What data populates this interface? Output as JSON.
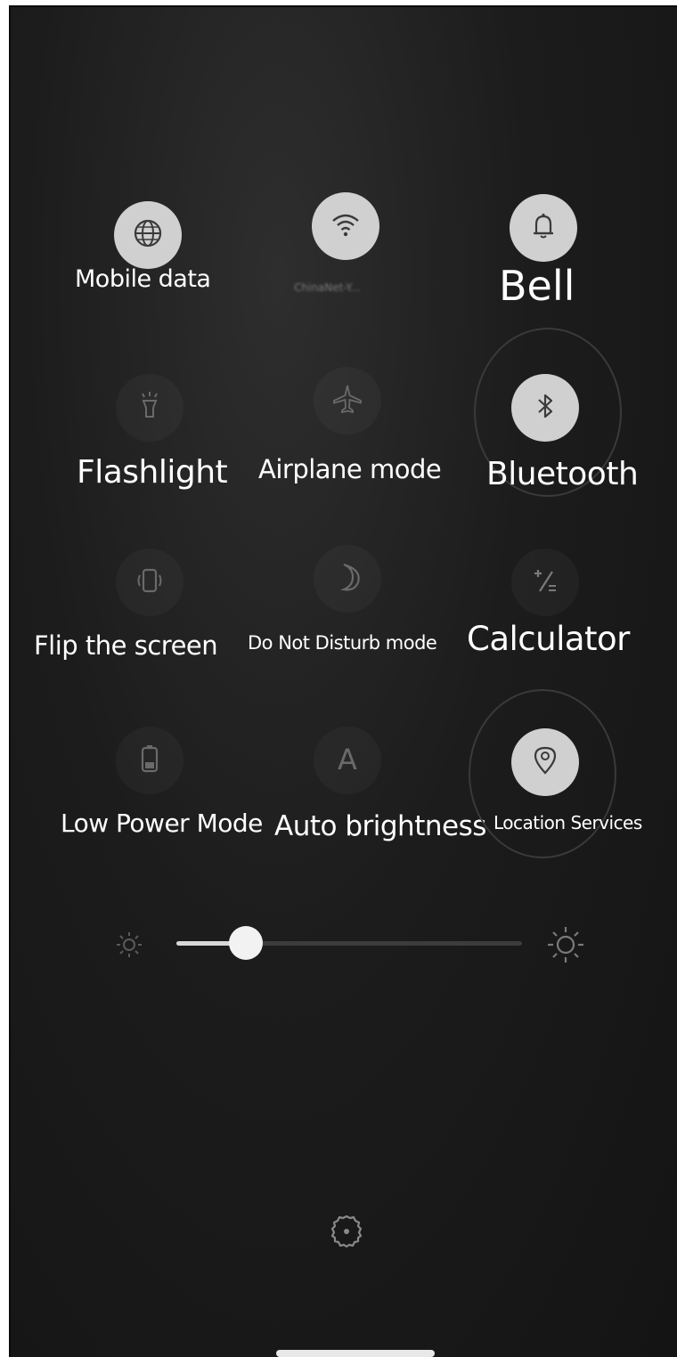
{
  "panel": {
    "tiles": [
      {
        "label": "Mobile data",
        "icon": "globe-icon",
        "state": "on"
      },
      {
        "label": "",
        "sublabel": "ChinaNet-Y...",
        "icon": "wifi-icon",
        "state": "on"
      },
      {
        "label": "Bell",
        "icon": "bell-icon",
        "state": "on"
      },
      {
        "label": "Flashlight",
        "icon": "flashlight-icon",
        "state": "off"
      },
      {
        "label": "Airplane mode",
        "icon": "airplane-icon",
        "state": "off"
      },
      {
        "label": "Bluetooth",
        "icon": "bluetooth-icon",
        "state": "on",
        "highlighted": true
      },
      {
        "label": "Flip the screen",
        "icon": "rotate-screen-icon",
        "state": "off"
      },
      {
        "label": "Do Not Disturb mode",
        "icon": "moon-icon",
        "state": "off"
      },
      {
        "label": "Calculator",
        "icon": "calculator-icon",
        "state": "off"
      },
      {
        "label": "Low Power Mode",
        "icon": "battery-icon",
        "state": "off"
      },
      {
        "label": "Auto brightness",
        "icon": "auto-brightness-icon",
        "state": "off"
      },
      {
        "label": "Location Services",
        "icon": "location-icon",
        "state": "on",
        "highlighted": true
      }
    ]
  },
  "brightness": {
    "level": 0.2,
    "min_icon": "brightness-low-icon",
    "max_icon": "brightness-high-icon"
  },
  "footer": {
    "settings_icon": "settings-gear-icon"
  },
  "colors": {
    "background": "#1a1a1a",
    "tile_on": "#d0d0d0",
    "tile_off": "#202020",
    "label": "#ffffff"
  }
}
